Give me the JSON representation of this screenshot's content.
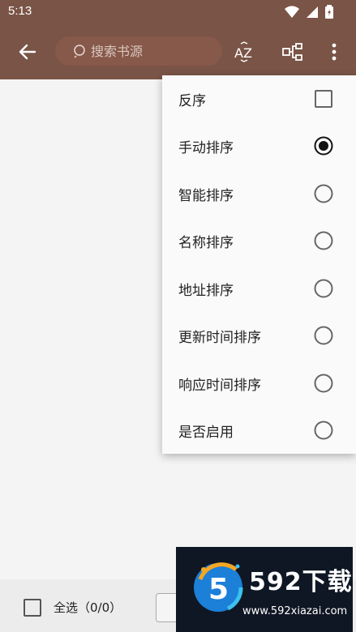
{
  "status_bar": {
    "time": "5:13"
  },
  "toolbar": {
    "search_placeholder": "搜索书源",
    "sort_icon_label": "AZ"
  },
  "sort_menu": {
    "items": [
      {
        "label": "反序",
        "control": "checkbox",
        "checked": false
      },
      {
        "label": "手动排序",
        "control": "radio",
        "checked": true
      },
      {
        "label": "智能排序",
        "control": "radio",
        "checked": false
      },
      {
        "label": "名称排序",
        "control": "radio",
        "checked": false
      },
      {
        "label": "地址排序",
        "control": "radio",
        "checked": false
      },
      {
        "label": "更新时间排序",
        "control": "radio",
        "checked": false
      },
      {
        "label": "响应时间排序",
        "control": "radio",
        "checked": false
      },
      {
        "label": "是否启用",
        "control": "radio",
        "checked": false
      }
    ]
  },
  "bottom_bar": {
    "select_all_label": "全选（0/0）"
  },
  "watermark": {
    "brand": "592下载",
    "url": "www.592xiazai.com",
    "logo_text": "5"
  },
  "colors": {
    "toolbar": "#7a5446",
    "search_bg": "#87594b",
    "menu_bg": "#fafafa",
    "page_bg": "#f4f4f4"
  }
}
